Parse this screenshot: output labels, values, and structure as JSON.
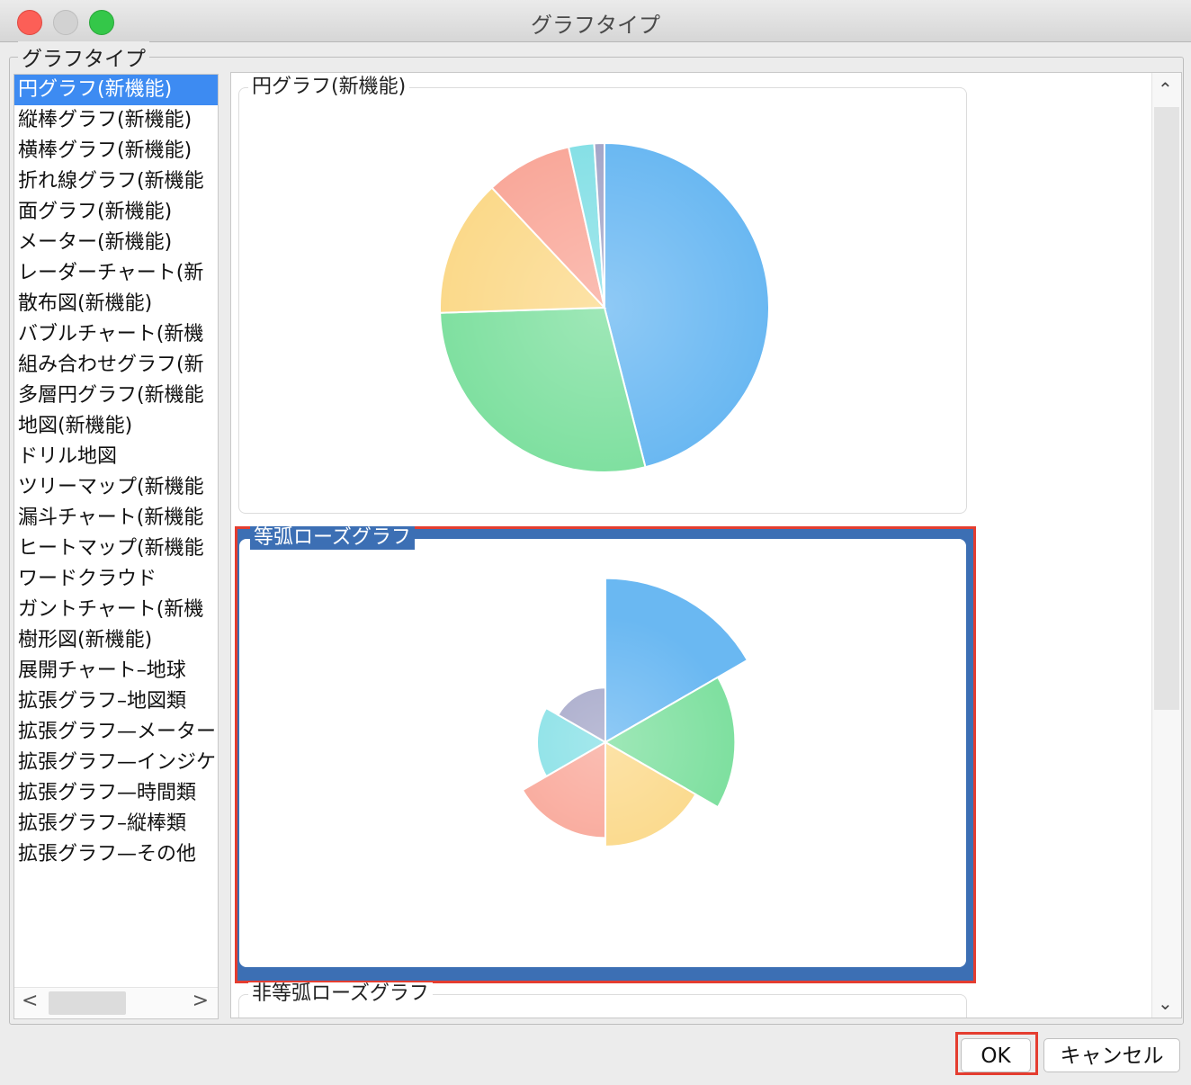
{
  "window": {
    "title": "グラフタイプ"
  },
  "group_label": "グラフタイプ",
  "chart_types": [
    {
      "label": "円グラフ(新機能)",
      "selected": true
    },
    {
      "label": "縦棒グラフ(新機能)"
    },
    {
      "label": "横棒グラフ(新機能)"
    },
    {
      "label": "折れ線グラフ(新機能"
    },
    {
      "label": "面グラフ(新機能)"
    },
    {
      "label": "メーター(新機能)"
    },
    {
      "label": "レーダーチャート(新"
    },
    {
      "label": "散布図(新機能)"
    },
    {
      "label": "バブルチャート(新機"
    },
    {
      "label": "組み合わせグラフ(新"
    },
    {
      "label": "多層円グラフ(新機能"
    },
    {
      "label": "地図(新機能)"
    },
    {
      "label": "ドリル地図"
    },
    {
      "label": "ツリーマップ(新機能"
    },
    {
      "label": "漏斗チャート(新機能"
    },
    {
      "label": "ヒートマップ(新機能"
    },
    {
      "label": "ワードクラウド"
    },
    {
      "label": "ガントチャート(新機"
    },
    {
      "label": "樹形図(新機能)"
    },
    {
      "label": "展開チャート–地球"
    },
    {
      "label": "拡張グラフ–地図類"
    },
    {
      "label": "拡張グラフ—メーター"
    },
    {
      "label": "拡張グラフ—インジケ"
    },
    {
      "label": "拡張グラフ—時間類"
    },
    {
      "label": "拡張グラフ–縦棒類"
    },
    {
      "label": "拡張グラフ—その他"
    }
  ],
  "previews": [
    {
      "title": "円グラフ(新機能)",
      "selected": false
    },
    {
      "title": "等弧ローズグラフ",
      "selected": true
    },
    {
      "title": "非等弧ローズグラフ",
      "selected": false
    }
  ],
  "buttons": {
    "ok": "OK",
    "cancel": "キャンセル"
  },
  "colors": {
    "accent_selection": "#3d8bf2",
    "card_selected": "#3c6fb4",
    "highlight_red": "#e43d30",
    "slice_blue": "#6ab8f2",
    "slice_green": "#7fe0a0",
    "slice_yellow": "#fbd98a",
    "slice_red": "#f9a89a",
    "slice_cyan": "#86e0e6",
    "slice_gray": "#a4a6c8"
  },
  "chart_data": [
    {
      "type": "pie",
      "title": "",
      "values": [
        46,
        28.5,
        13.5,
        8.5,
        2.5,
        1
      ]
    },
    {
      "type": "pie",
      "title": "",
      "values": [
        1,
        1,
        1,
        1,
        1,
        1
      ],
      "radii": [
        192,
        152,
        122,
        112,
        80,
        64
      ]
    }
  ]
}
